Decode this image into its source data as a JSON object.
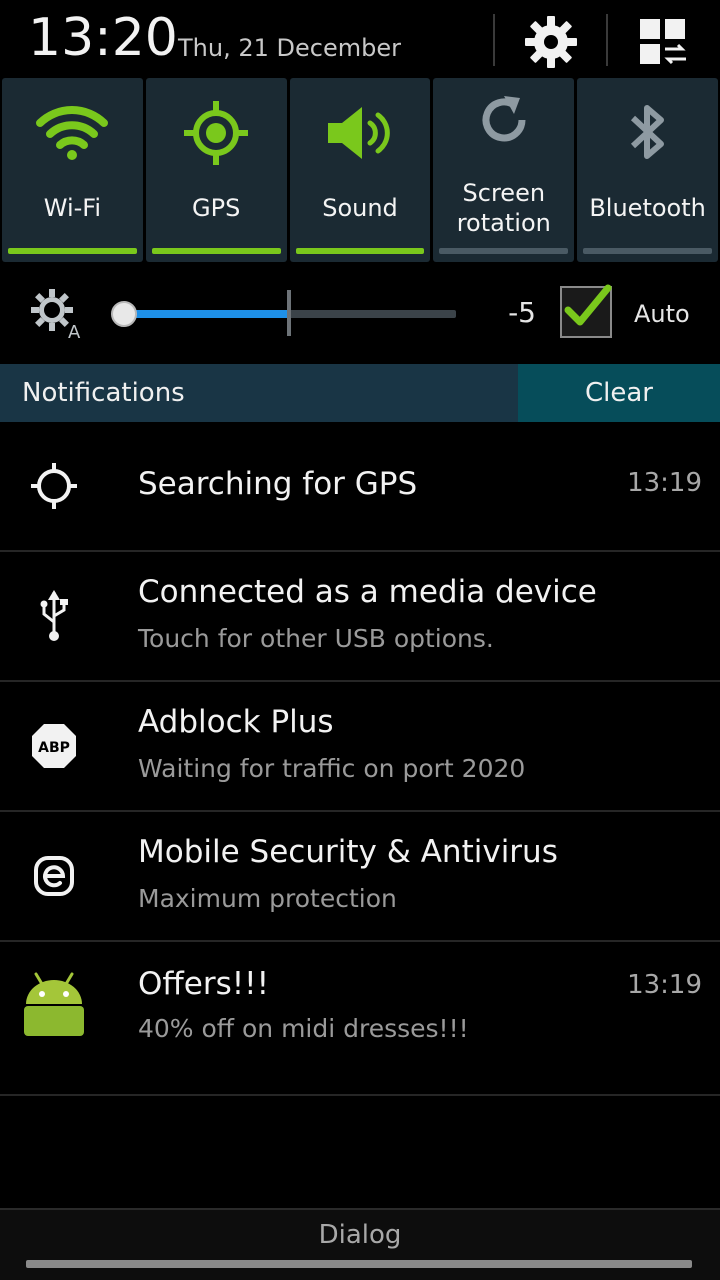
{
  "header": {
    "time": "13:20",
    "date": "Thu, 21 December"
  },
  "toggles": [
    {
      "label": "Wi-Fi",
      "icon": "wifi-icon",
      "state": "on"
    },
    {
      "label": "GPS",
      "icon": "gps-icon",
      "state": "on"
    },
    {
      "label": "Sound",
      "icon": "sound-icon",
      "state": "on"
    },
    {
      "label_line1": "Screen",
      "label_line2": "rotation",
      "icon": "rotation-icon",
      "state": "off"
    },
    {
      "label": "Bluetooth",
      "icon": "bluetooth-icon",
      "state": "off"
    }
  ],
  "brightness": {
    "value": "-5",
    "level": 0.5,
    "auto_label": "Auto",
    "auto_checked": true
  },
  "notifications_header": {
    "title": "Notifications",
    "clear_label": "Clear"
  },
  "notifications": [
    {
      "title": "Searching for GPS",
      "subtitle": "",
      "time": "13:19",
      "icon": "gps-crosshair-icon"
    },
    {
      "title": "Connected as a media device",
      "subtitle": "Touch for other USB options.",
      "time": "",
      "icon": "usb-icon"
    },
    {
      "title": "Adblock Plus",
      "subtitle": "Waiting for traffic on port 2020",
      "time": "",
      "icon": "abp-icon"
    },
    {
      "title": "Mobile Security & Antivirus",
      "subtitle": "Maximum protection",
      "time": "",
      "icon": "eset-icon"
    },
    {
      "title": "Offers!!!",
      "subtitle": "40% off on midi dresses!!!",
      "time": "13:19",
      "icon": "android-icon"
    }
  ],
  "bottom": {
    "label": "Dialog"
  },
  "colors": {
    "active_green": "#7ac81c",
    "tile_bg": "#1b2a33",
    "slider_blue": "#1e90e8",
    "notif_header_bg": "#193545",
    "clear_bg": "#064d5a"
  }
}
